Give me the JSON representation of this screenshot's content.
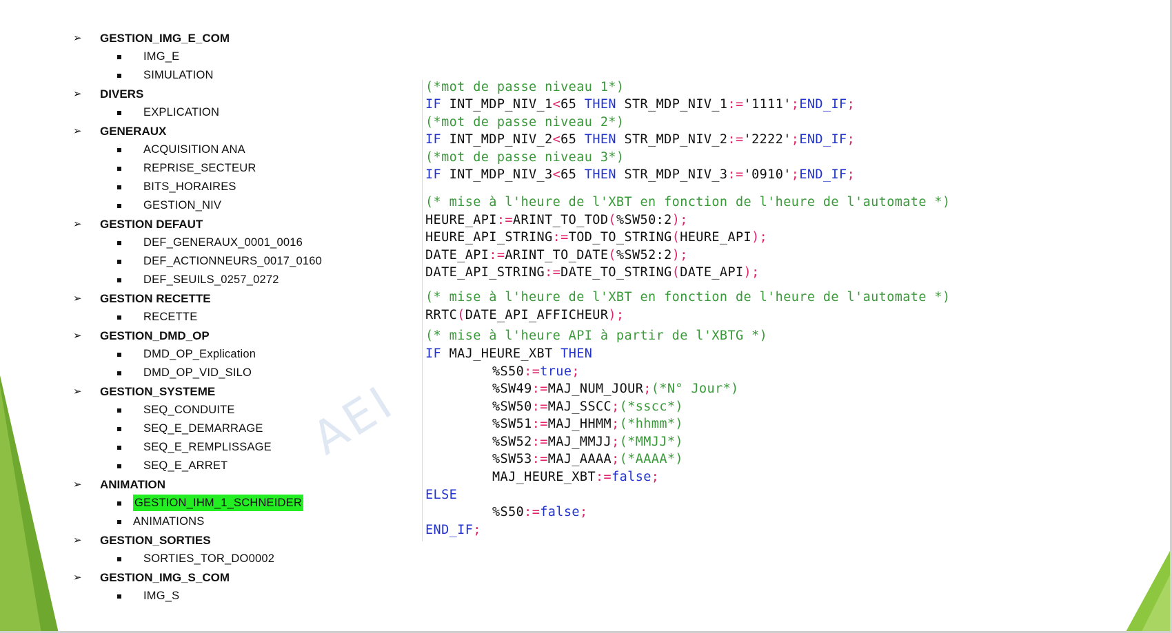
{
  "colors": {
    "accent_green": "#8dc63f",
    "highlight": "#22ee22",
    "comment": "#3a9a3a",
    "keyword": "#2233cc",
    "operator": "#e0226a"
  },
  "outline": [
    {
      "title": "GESTION_IMG_E_COM",
      "items": [
        "IMG_E",
        "SIMULATION"
      ]
    },
    {
      "title": "DIVERS",
      "items": [
        "EXPLICATION"
      ]
    },
    {
      "title": "GENERAUX",
      "items": [
        "ACQUISITION ANA",
        "REPRISE_SECTEUR",
        "BITS_HORAIRES",
        "GESTION_NIV"
      ]
    },
    {
      "title": "GESTION DEFAUT",
      "items": [
        "DEF_GENERAUX_0001_0016",
        "DEF_ACTIONNEURS_0017_0160",
        "DEF_SEUILS_0257_0272"
      ]
    },
    {
      "title": "GESTION RECETTE",
      "items": [
        "RECETTE"
      ]
    },
    {
      "title": "GESTION_DMD_OP",
      "items": [
        "DMD_OP_Explication",
        "DMD_OP_VID_SILO"
      ]
    },
    {
      "title": "GESTION_SYSTEME",
      "items": [
        "SEQ_CONDUITE",
        "SEQ_E_DEMARRAGE",
        "SEQ_E_REMPLISSAGE",
        "SEQ_E_ARRET"
      ]
    },
    {
      "title": "ANIMATION",
      "items": [
        "GESTION_IHM_1_SCHNEIDER",
        "ANIMATIONS"
      ]
    },
    {
      "title": "GESTION_SORTIES",
      "items": [
        "SORTIES_TOR_DO0002"
      ]
    },
    {
      "title": "GESTION_IMG_S_COM",
      "items": [
        "IMG_S"
      ]
    }
  ],
  "watermark": "AEI",
  "code": {
    "c1": "(*mot de passe niveau 1*)",
    "l2a": "IF",
    "l2b": " INT_MDP_NIV_1",
    "l2c": "<",
    "l2d": "65 ",
    "l2e": "THEN",
    "l2f": " STR_MDP_NIV_1",
    "l2g": ":=",
    "l2h": "'1111'",
    "l2i": ";",
    "l2j": "END_IF",
    "l2k": ";",
    "c3": "(*mot de passe niveau 2*)",
    "l4a": "IF",
    "l4b": " INT_MDP_NIV_2",
    "l4c": "<",
    "l4d": "65 ",
    "l4e": "THEN",
    "l4f": " STR_MDP_NIV_2",
    "l4g": ":=",
    "l4h": "'2222'",
    "l4i": ";",
    "l4j": "END_IF",
    "l4k": ";",
    "c5": "(*mot de passe niveau 3*)",
    "l6a": "IF",
    "l6b": " INT_MDP_NIV_3",
    "l6c": "<",
    "l6d": "65 ",
    "l6e": "THEN",
    "l6f": " STR_MDP_NIV_3",
    "l6g": ":=",
    "l6h": "'0910'",
    "l6i": ";",
    "l6j": "END_IF",
    "l6k": ";",
    "c7": "(* mise à l'heure de l'XBT en fonction de l'heure de l'automate *)",
    "l8a": "HEURE_API",
    "l8b": ":=",
    "l8c": "ARINT_TO_TOD",
    "l8d": "(",
    "l8e": "%SW50:2",
    "l8f": ");",
    "l9a": "HEURE_API_STRING",
    "l9b": ":=",
    "l9c": "TOD_TO_STRING",
    "l9d": "(",
    "l9e": "HEURE_API",
    "l9f": ");",
    "l10a": "DATE_API",
    "l10b": ":=",
    "l10c": "ARINT_TO_DATE",
    "l10d": "(",
    "l10e": "%SW52:2",
    "l10f": ");",
    "l11a": "DATE_API_STRING",
    "l11b": ":=",
    "l11c": "DATE_TO_STRING",
    "l11d": "(",
    "l11e": "DATE_API",
    "l11f": ");",
    "c12": "(* mise à l'heure de l'XBT en fonction de l'heure de l'automate *)",
    "l13a": "RRTC",
    "l13b": "(",
    "l13c": "DATE_API_AFFICHEUR",
    "l13d": ");",
    "c14": "(* mise à l'heure API à partir de l'XBTG *)",
    "l15a": "IF",
    "l15b": " MAJ_HEURE_XBT ",
    "l15c": "THEN",
    "l16a": "%S50",
    "l16b": ":=",
    "l16c": "true",
    "l16d": ";",
    "l17a": "%SW49",
    "l17b": ":=",
    "l17c": "MAJ_NUM_JOUR",
    "l17d": ";",
    "l17e": "(*N° Jour*)",
    "l18a": "%SW50",
    "l18b": ":=",
    "l18c": "MAJ_SSCC",
    "l18d": ";",
    "l18e": "(*sscc*)",
    "l19a": "%SW51",
    "l19b": ":=",
    "l19c": "MAJ_HHMM",
    "l19d": ";",
    "l19e": "(*hhmm*)",
    "l20a": "%SW52",
    "l20b": ":=",
    "l20c": "MAJ_MMJJ",
    "l20d": ";",
    "l20e": "(*MMJJ*)",
    "l21a": "%SW53",
    "l21b": ":=",
    "l21c": "MAJ_AAAA",
    "l21d": ";",
    "l21e": "(*AAAA*)",
    "l22a": "MAJ_HEURE_XBT",
    "l22b": ":=",
    "l22c": "false",
    "l22d": ";",
    "l23": "ELSE",
    "l24a": "%S50",
    "l24b": ":=",
    "l24c": "false",
    "l24d": ";",
    "l25a": "END_IF",
    "l25b": ";"
  }
}
